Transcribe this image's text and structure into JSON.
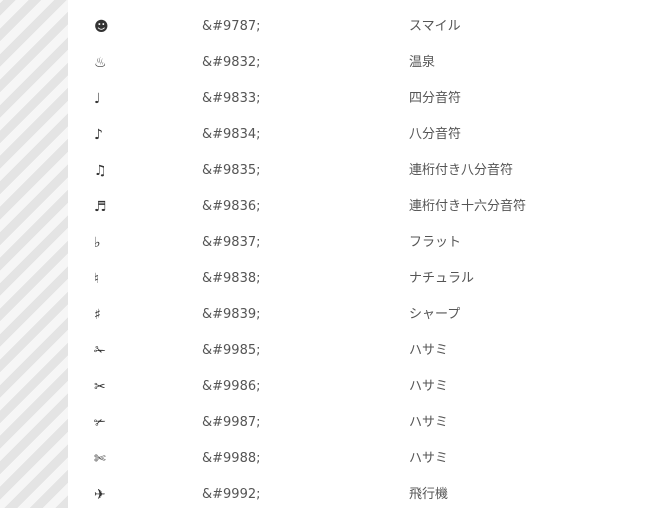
{
  "rows": [
    {
      "char": "☻",
      "code": "&#9787;",
      "name": "スマイル"
    },
    {
      "char": "♨",
      "code": "&#9832;",
      "name": "温泉"
    },
    {
      "char": "♩",
      "code": "&#9833;",
      "name": "四分音符"
    },
    {
      "char": "♪",
      "code": "&#9834;",
      "name": "八分音符"
    },
    {
      "char": "♫",
      "code": "&#9835;",
      "name": "連桁付き八分音符"
    },
    {
      "char": "♬",
      "code": "&#9836;",
      "name": "連桁付き十六分音符"
    },
    {
      "char": "♭",
      "code": "&#9837;",
      "name": "フラット"
    },
    {
      "char": "♮",
      "code": "&#9838;",
      "name": "ナチュラル"
    },
    {
      "char": "♯",
      "code": "&#9839;",
      "name": "シャープ"
    },
    {
      "char": "✁",
      "code": "&#9985;",
      "name": "ハサミ"
    },
    {
      "char": "✂",
      "code": "&#9986;",
      "name": "ハサミ"
    },
    {
      "char": "✃",
      "code": "&#9987;",
      "name": "ハサミ"
    },
    {
      "char": "✄",
      "code": "&#9988;",
      "name": "ハサミ"
    },
    {
      "char": "✈",
      "code": "&#9992;",
      "name": "飛行機"
    }
  ]
}
